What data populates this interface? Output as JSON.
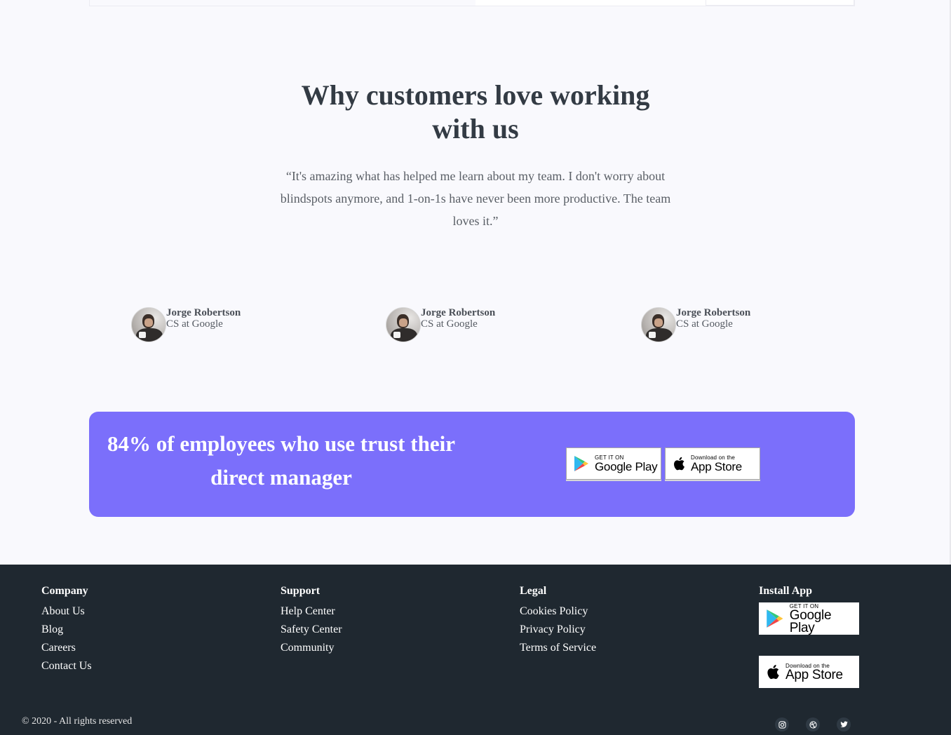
{
  "section": {
    "title": "Why customers love working with us",
    "quote": "“It's amazing what has helped me learn about my team. I don't worry about blindspots anymore, and 1-on-1s have never been more productive. The team loves it.”"
  },
  "authors": [
    {
      "name": "Jorge Robertson",
      "role": "CS at Google"
    },
    {
      "name": "Jorge Robertson",
      "role": "CS at Google"
    },
    {
      "name": "Jorge Robertson",
      "role": "CS at Google"
    }
  ],
  "cta": {
    "headline": "84% of employees who use trust their direct manager",
    "google_play": {
      "small": "GET IT ON",
      "big": "Google Play"
    },
    "app_store": {
      "small": "Download on the",
      "big": "App Store"
    },
    "background_color": "#7b6ffb"
  },
  "footer": {
    "company": {
      "heading": "Company",
      "links": [
        "About Us",
        "Blog",
        "Careers",
        "Contact Us"
      ]
    },
    "support": {
      "heading": "Support",
      "links": [
        "Help Center",
        "Safety Center",
        "Community"
      ]
    },
    "legal": {
      "heading": "Legal",
      "links": [
        "Cookies Policy",
        "Privacy Policy",
        "Terms of Service"
      ]
    },
    "install": {
      "heading": "Install App",
      "google_play": {
        "small": "GET IT ON",
        "big": "Google Play"
      },
      "app_store": {
        "small": "Download on the",
        "big": "App Store"
      }
    },
    "copyright": "© 2020 - All rights reserved",
    "social": [
      "instagram-icon",
      "dribbble-icon",
      "twitter-icon"
    ],
    "background_color": "#1f2830"
  }
}
